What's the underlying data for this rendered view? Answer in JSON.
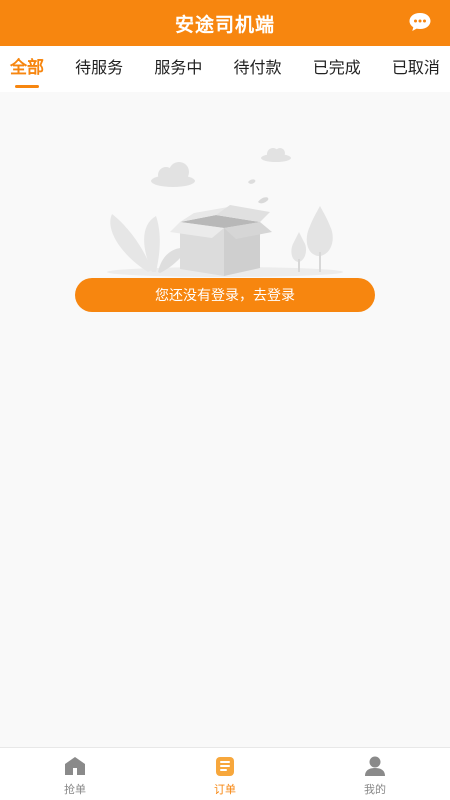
{
  "header": {
    "title": "安途司机端",
    "message_icon": "chat-bubble-icon"
  },
  "tabs": [
    {
      "label": "全部",
      "active": true
    },
    {
      "label": "待服务",
      "active": false
    },
    {
      "label": "服务中",
      "active": false
    },
    {
      "label": "待付款",
      "active": false
    },
    {
      "label": "已完成",
      "active": false
    },
    {
      "label": "已取消",
      "active": false
    }
  ],
  "empty_state": {
    "illustration": "empty-box-icon",
    "login_button": "您还没有登录，去登录"
  },
  "bottom_nav": {
    "items": [
      {
        "label": "抢单",
        "icon": "home-icon",
        "active": false
      },
      {
        "label": "订单",
        "icon": "order-list-icon",
        "active": true
      },
      {
        "label": "我的",
        "icon": "user-icon",
        "active": false
      }
    ]
  },
  "colors": {
    "accent": "#f7860f",
    "background": "#f9f9f9",
    "inactive_text": "#888888"
  }
}
